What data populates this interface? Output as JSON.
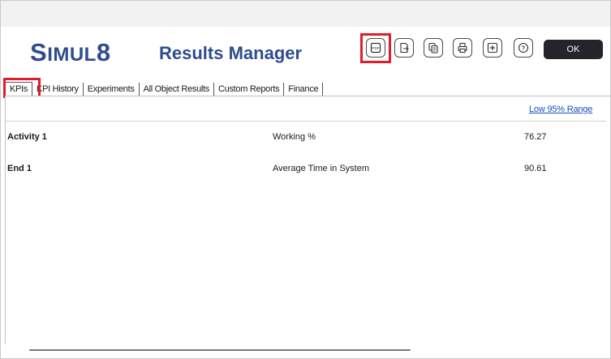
{
  "app": {
    "logo_prefix": "S",
    "logo_smallcaps": "IMUL",
    "logo_suffix": "8",
    "title": "Results Manager"
  },
  "toolbar": {
    "buttons": [
      {
        "name": "pdf-export",
        "icon": "pdf-icon",
        "highlighted": true
      },
      {
        "name": "export",
        "icon": "export-icon"
      },
      {
        "name": "copy",
        "icon": "copy-icon"
      },
      {
        "name": "print",
        "icon": "print-icon"
      },
      {
        "name": "add",
        "icon": "plus-icon"
      },
      {
        "name": "help",
        "icon": "help-icon"
      }
    ],
    "ok_label": "OK"
  },
  "tabs": [
    {
      "label": "KPIs",
      "active": true
    },
    {
      "label": "KPI History"
    },
    {
      "label": "Experiments"
    },
    {
      "label": "All Object Results"
    },
    {
      "label": "Custom Reports"
    },
    {
      "label": "Finance"
    }
  ],
  "results": {
    "range_link": "Low 95% Range",
    "rows": [
      {
        "object": "Activity 1",
        "kpi": "Working %",
        "value": "76.27"
      },
      {
        "object": "End 1",
        "kpi": "Average Time in System",
        "value": "90.61"
      }
    ]
  },
  "colors": {
    "brand": "#2e4d8e",
    "highlight": "#e01e2b",
    "ok_button": "#23252b",
    "link": "#1a4fc4"
  }
}
